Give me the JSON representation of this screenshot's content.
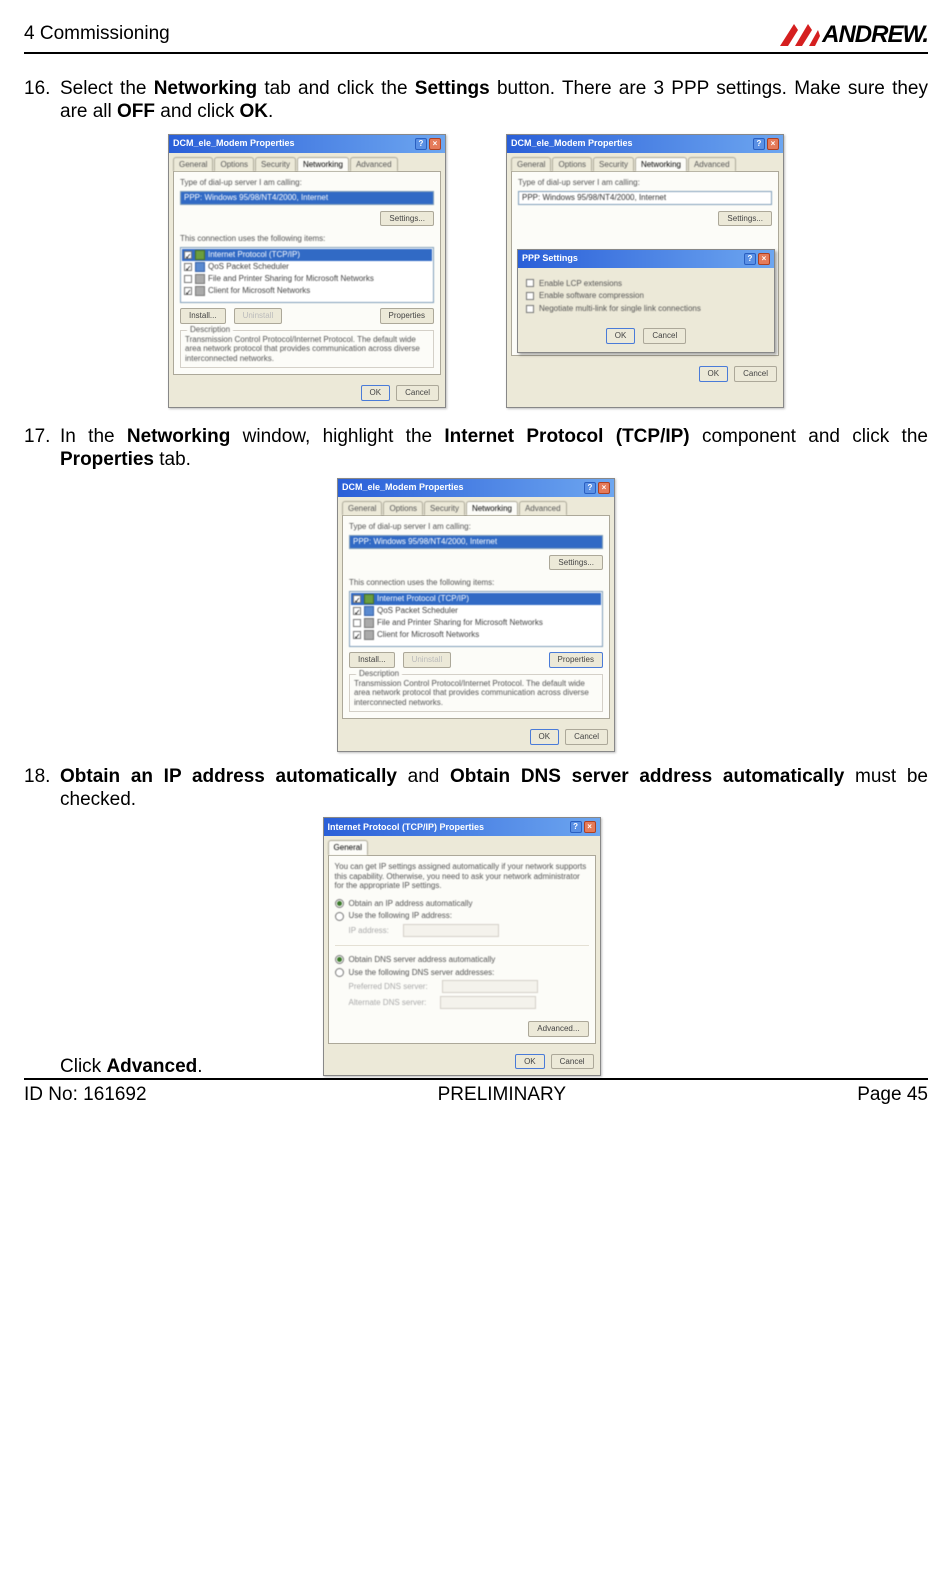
{
  "header": {
    "section": "4 Commissioning",
    "logo_text": "ANDREW."
  },
  "steps": {
    "s16": {
      "num": "16.",
      "html": "Select the <b>Networking</b> tab and click the <b>Settings</b> button. There are 3 PPP settings. Make sure they are all <b>OFF</b> and click <b>OK</b>."
    },
    "s17": {
      "num": "17.",
      "html": "In the <b>Networking</b> window, highlight the <b>Internet Protocol (TCP/IP)</b> component and click the <b>Properties</b> tab."
    },
    "s18": {
      "num": "18.",
      "html": "<b>Obtain an IP address automatically</b> and <b>Obtain DNS server address automatically</b> must be checked.",
      "trailer": "Click <b>Advanced</b>."
    }
  },
  "dlg": {
    "props_title": "DCM_ele_Modem Properties",
    "tcpip_title": "Internet Protocol (TCP/IP) Properties",
    "ppp_title": "PPP Settings",
    "tabs": [
      "General",
      "Options",
      "Security",
      "Networking",
      "Advanced"
    ],
    "type_lbl": "Type of dial-up server I am calling:",
    "type_val": "PPP: Windows 95/98/NT4/2000, Internet",
    "settings": "Settings...",
    "uses_lbl": "This connection uses the following items:",
    "items": [
      "Internet Protocol (TCP/IP)",
      "QoS Packet Scheduler",
      "File and Printer Sharing for Microsoft Networks",
      "Client for Microsoft Networks"
    ],
    "install": "Install...",
    "uninstall": "Uninstall",
    "properties": "Properties",
    "desc_hdr": "Description",
    "desc_txt": "Transmission Control Protocol/Internet Protocol. The default wide area network protocol that provides communication across diverse interconnected networks.",
    "ok": "OK",
    "cancel": "Cancel",
    "ppp_opts": [
      "Enable LCP extensions",
      "Enable software compression",
      "Negotiate multi-link for single link connections"
    ],
    "ip_general": "General",
    "ip_intro": "You can get IP settings assigned automatically if your network supports this capability. Otherwise, you need to ask your network administrator for the appropriate IP settings.",
    "ip_auto": "Obtain an IP address automatically",
    "ip_use": "Use the following IP address:",
    "ip_addr": "IP address:",
    "dns_auto": "Obtain DNS server address automatically",
    "dns_use": "Use the following DNS server addresses:",
    "dns_pref": "Preferred DNS server:",
    "dns_alt": "Alternate DNS server:",
    "advanced": "Advanced..."
  },
  "footer": {
    "left": "ID No: 161692",
    "center": "PRELIMINARY",
    "right": "Page 45"
  }
}
